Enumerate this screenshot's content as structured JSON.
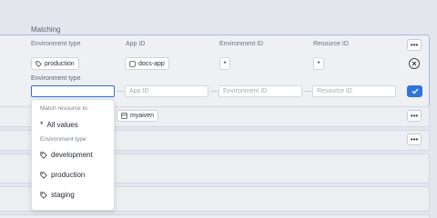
{
  "section": {
    "label": "Matching"
  },
  "columns": {
    "environment_type": "Environment type",
    "app_id": "App ID",
    "environment_id": "Environment ID",
    "resource_id": "Resource ID"
  },
  "matching_row": {
    "environment_type_value": "production",
    "app_id_value": "docs-app",
    "environment_id_value": "*",
    "resource_id_value": "*",
    "more_label": "•••"
  },
  "editor": {
    "label": "Environment type",
    "environment_type_value": "",
    "app_id_placeholder": "App ID",
    "environment_id_placeholder": "Environment ID",
    "resource_id_placeholder": "Resource ID"
  },
  "dropdown": {
    "header": "Match resource to",
    "all_values": "All values",
    "group_header": "Environment type",
    "options": [
      "development",
      "production",
      "staging"
    ]
  },
  "rows": [
    {
      "tag": "myaiven",
      "more_label": "•••"
    },
    {
      "more_label": "•••"
    }
  ],
  "colors": {
    "accent": "#2f74d8",
    "panel_border": "#a9b7e8"
  }
}
